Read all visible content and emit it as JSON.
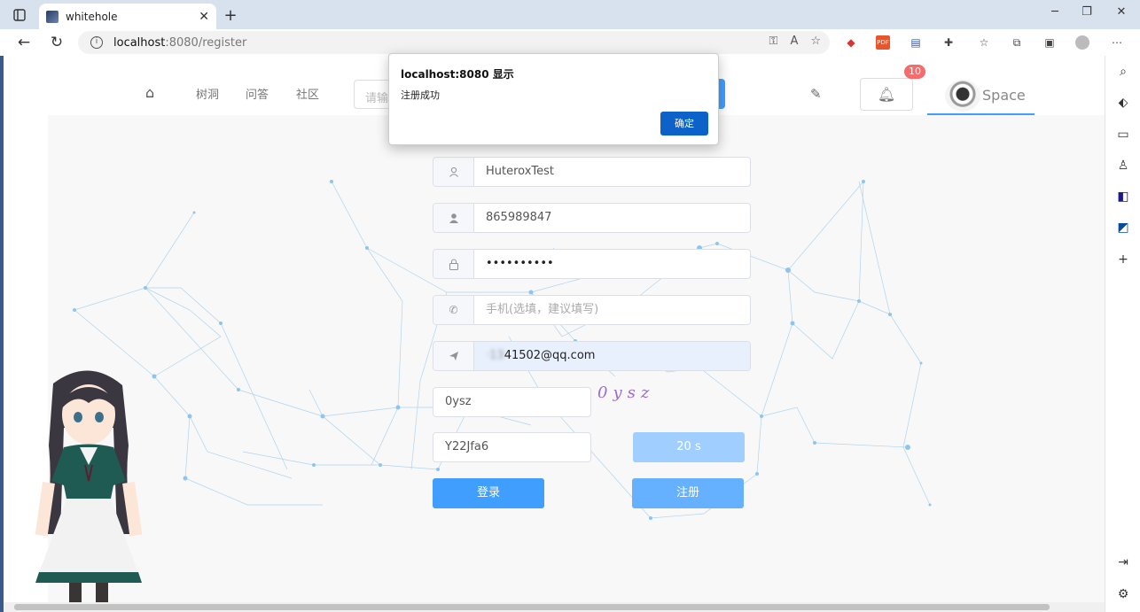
{
  "browser": {
    "tab_title": "whitehole",
    "url_host": "localhost",
    "url_path": ":8080/register"
  },
  "header": {
    "nav": [
      "树洞",
      "问答",
      "社区"
    ],
    "search_placeholder": "请输",
    "notification_count": "10",
    "space_label": "Space"
  },
  "form": {
    "username": "HuteroxTest",
    "account": "865989847",
    "password": "••••••••••",
    "phone_placeholder": "手机(选填，建议填写)",
    "email_prefix": "·13",
    "email_suffix": "41502@qq.com",
    "captcha_input": "0ysz",
    "captcha_image_text": "0ysz",
    "email_code": "Y22Jfa6",
    "countdown_label": "20 s",
    "login_label": "登录",
    "register_label": "注册"
  },
  "dialog": {
    "title": "localhost:8080 显示",
    "message": "注册成功",
    "ok_label": "确定"
  },
  "colors": {
    "primary": "#409eff",
    "primary_light": "#a0cfff",
    "dialog_button": "#0c62c8",
    "badge": "#f56c6c"
  }
}
